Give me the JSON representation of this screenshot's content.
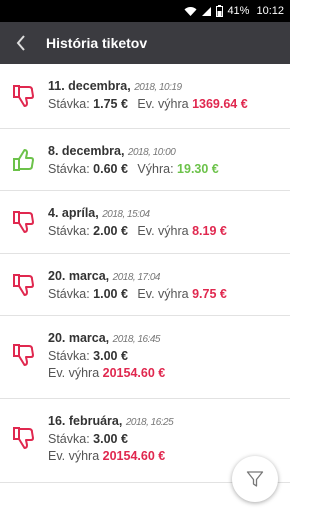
{
  "status": {
    "battery": "41%",
    "time": "10:12"
  },
  "header": {
    "title": "História tiketov"
  },
  "labels": {
    "stake": "Stávka:",
    "potential_win": "Ev. výhra",
    "win": "Výhra:"
  },
  "tickets": [
    {
      "date": "11. decembra,",
      "time_scribble": "2018, 10:19",
      "stake": "1.75 €",
      "win": "1369.64 €",
      "status": "lost"
    },
    {
      "date": "8. decembra,",
      "time_scribble": "2018, 10:00",
      "stake": "0.60 €",
      "win": "19.30 €",
      "status": "won"
    },
    {
      "date": "4. apríla,",
      "time_scribble": "2018, 15:04",
      "stake": "2.00 €",
      "win": "8.19 €",
      "status": "lost"
    },
    {
      "date": "20. marca,",
      "time_scribble": "2018, 17:04",
      "stake": "1.00 €",
      "win": "9.75 €",
      "status": "lost"
    },
    {
      "date": "20. marca,",
      "time_scribble": "2018, 16:45",
      "stake": "3.00 €",
      "win": "20154.60 €",
      "status": "lost"
    },
    {
      "date": "16. februára,",
      "time_scribble": "2018, 16:25",
      "stake": "3.00 €",
      "win": "20154.60 €",
      "status": "lost"
    }
  ],
  "colors": {
    "lost": "#e0284f",
    "won": "#6cc24a",
    "appbar": "#3b3b40"
  },
  "icons": {
    "lost": "thumbs-down-icon",
    "won": "thumbs-up-icon",
    "fab": "filter-icon",
    "back": "chevron-left-icon"
  }
}
